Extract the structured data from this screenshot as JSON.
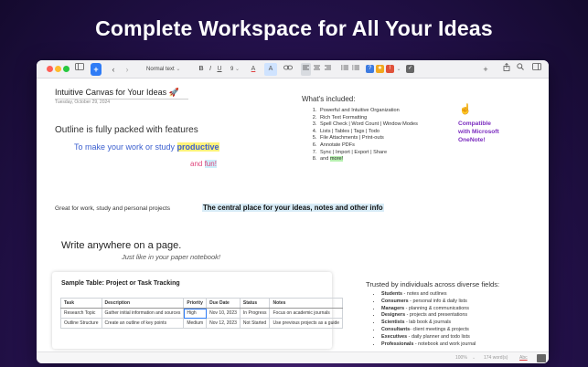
{
  "hero": {
    "title": "Complete Workspace for All Your Ideas"
  },
  "toolbar": {
    "style_select": "Normal text",
    "bold": "B",
    "italic": "I",
    "underline": "U",
    "font_size": "9",
    "text_color_label": "A",
    "highlight_label": "A",
    "add_label": "+"
  },
  "doc": {
    "title": "Intuitive Canvas for Your Ideas 🚀",
    "date": "Tuesday, October 29, 2024",
    "outline_heading": "Outline is fully packed with features",
    "outline_line_prefix": "To make your work or study ",
    "outline_line_highlight": "productive",
    "fun_prefix": "and ",
    "fun_word": "fun!",
    "great_for": "Great for work, study and personal projects",
    "central_place": "The central place for your ideas, notes and other info",
    "write_anywhere": "Write anywhere on a page.",
    "paper_notebook": "Just like in your paper notebook!",
    "included_heading": "What's included:",
    "included_items": [
      "Powerful and Intuitive Organization",
      "Rich Text Formatting",
      "Spell Check | Word Count | Window Modes",
      "Lists | Tables | Tags | Todo",
      "File Attachments | Print-outs",
      "Annotate PDFs",
      "Sync | Import | Export | Share"
    ],
    "included_last_prefix": "and ",
    "included_last_highlight": "more!",
    "compat_emoji": "☝️",
    "compat_lines": [
      "Compatible",
      "with Microsoft",
      "OneNote!"
    ],
    "trusted_heading": "Trusted by individuals across diverse fields:",
    "trusted": [
      {
        "role": "Students",
        "text": " - notes and outlines"
      },
      {
        "role": "Consumers",
        "text": " - personal info & daily lists"
      },
      {
        "role": "Managers",
        "text": " - planning & communications"
      },
      {
        "role": "Designers",
        "text": " - projects and presentations"
      },
      {
        "role": "Scientists",
        "text": " - lab book & journals"
      },
      {
        "role": "Consultants",
        "text": "- client meetings & projects"
      },
      {
        "role": "Executives",
        "text": " - daily planner and todo lists"
      },
      {
        "role": "Professionals",
        "text": " - notebook and work journal"
      }
    ]
  },
  "table": {
    "title": "Sample Table: Project or Task Tracking",
    "headers": [
      "Task",
      "Description",
      "Priority",
      "Due Date",
      "Status",
      "Notes"
    ],
    "rows": [
      [
        "Research Topic",
        "Gather initial information and sources",
        "High",
        "Nov 10, 2023",
        "In Progress",
        "Focus on academic journals"
      ],
      [
        "Outline Structure",
        "Create an outline of key points",
        "Medium",
        "Nov 12, 2023",
        "Not Started",
        "Use previous projects as a guide"
      ]
    ]
  },
  "statusbar": {
    "zoom": "100%",
    "words": "174 word(s)",
    "spell": "Abc"
  },
  "colors": {
    "accent": "#2f7cf6",
    "purple_text": "#7b2cbf",
    "blue_text": "#3b5fcf",
    "pink_text": "#e0457b",
    "yellow_highlight": "#fff27a",
    "cyan_highlight": "#cdeefa",
    "green_highlight": "#b7f0b0"
  },
  "icons": [
    "sidebar-icon",
    "back-chevron-icon",
    "forward-chevron-icon",
    "link-icon",
    "align-left-icon",
    "align-center-icon",
    "align-right-icon",
    "bulleted-list-icon",
    "numbered-list-icon",
    "help-icon",
    "star-icon",
    "alert-icon",
    "checkbox-icon",
    "share-icon",
    "search-icon",
    "sidebar-right-icon",
    "fullscreen-icon"
  ]
}
